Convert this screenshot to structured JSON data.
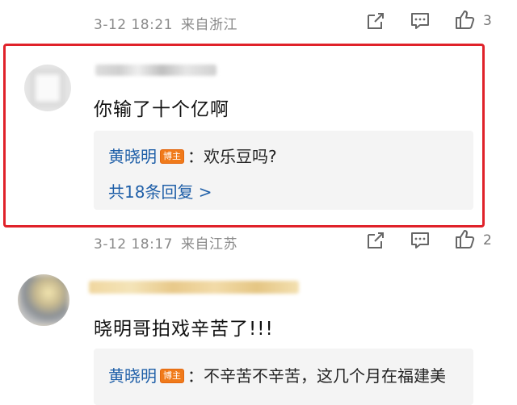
{
  "comments": [
    {
      "meta": {
        "date": "3-12 18:21",
        "location": "来自浙江",
        "likes": "3"
      }
    },
    {
      "text": "你输了十个亿啊",
      "reply": {
        "author": "黄晓明",
        "badge": "博主",
        "body": "：欢乐豆吗?"
      },
      "more_replies": "共18条回复 >",
      "meta": {
        "date": "3-12 18:17",
        "location": "来自江苏",
        "likes": "2"
      }
    },
    {
      "text": "晓明哥拍戏辛苦了!!!",
      "reply": {
        "author": "黄晓明",
        "badge": "博主",
        "body": "：不辛苦不辛苦，这几个月在福建美"
      }
    }
  ],
  "icons": [
    "share-icon",
    "comment-icon",
    "like-icon"
  ],
  "colors": {
    "highlight": "#e0222a",
    "link": "#1f5fa8",
    "badge": "#f07a1a",
    "meta": "#8a8a8a"
  }
}
